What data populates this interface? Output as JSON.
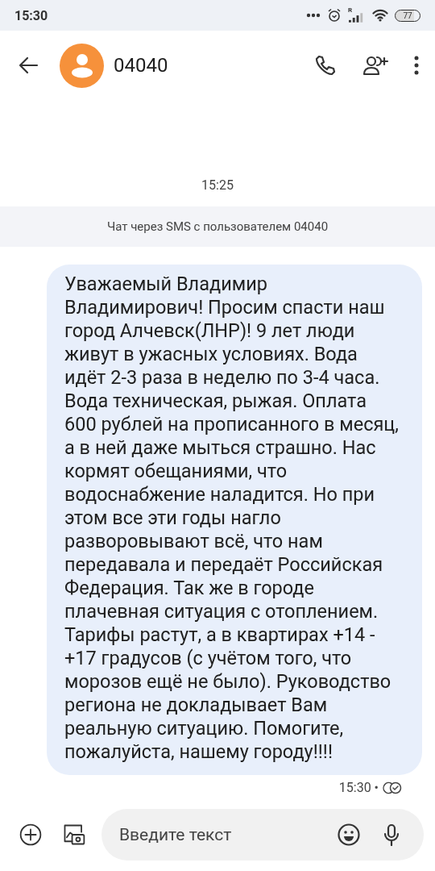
{
  "status_bar": {
    "time": "15:30",
    "signal_label": "R",
    "battery": "77"
  },
  "header": {
    "contact": "04040"
  },
  "thread": {
    "timestamp": "15:25",
    "banner": "Чат через SMS с пользователем 04040",
    "messages": [
      {
        "text": "Уважаемый Владимир Владимирович! Просим спасти наш город Алчевск(ЛНР)! 9 лет люди живут в ужасных условиях. Вода идёт 2-3 раза в неделю по 3-4 часа. Вода техническая, рыжая. Оплата 600 рублей на прописанного в месяц, а в ней даже мыться страшно. Нас кормят обещаниями, что водоснабжение наладится. Но при этом все эти годы нагло разворовывают всё, что нам передавала и передаёт Российская Федерация. Так же в городе плачевная ситуация с отоплением. Тарифы растут, а в квартирах +14 - +17 градусов (с учётом того, что морозов ещё не было). Руководство региона не докладывает Вам реальную ситуацию. Помогите, пожалуйста, нашему городу!!!!",
        "time": "15:30 •"
      }
    ]
  },
  "composer": {
    "placeholder": "Введите текст"
  }
}
